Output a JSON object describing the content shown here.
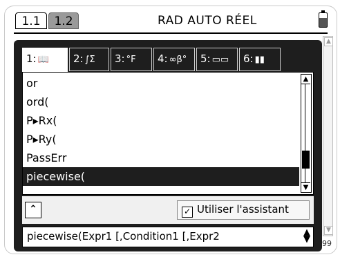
{
  "status_bar": {
    "pages": [
      {
        "label": "1.1",
        "active": true
      },
      {
        "label": "1.2",
        "active": false
      }
    ],
    "mode": "RAD AUTO RÉEL",
    "battery_icon": "battery-icon"
  },
  "catalog": {
    "tabs": [
      {
        "number": "1:",
        "icon": "book-icon",
        "glyph": "📖"
      },
      {
        "number": "2:",
        "icon": "integral-sigma-icon",
        "glyph": "∫Σ"
      },
      {
        "number": "3:",
        "icon": "units-icon",
        "glyph": "°F"
      },
      {
        "number": "4:",
        "icon": "symbols-icon",
        "glyph": "∞β°"
      },
      {
        "number": "5:",
        "icon": "templates-icon",
        "glyph": "▭▭"
      },
      {
        "number": "6:",
        "icon": "library-icon",
        "glyph": "▮▮"
      }
    ],
    "items": [
      "or",
      "ord(",
      "P▸Rx(",
      "P▸Ry(",
      "PassErr",
      "piecewise("
    ],
    "selected_index": 5,
    "scroll_position_fraction": 0.72,
    "wizard_label": "Utiliser l'assistant",
    "wizard_checked": true,
    "help_text": "piecewise(Expr1 [,Condition1 [,Expr2"
  },
  "document": {
    "page_number_fragment": "99"
  }
}
